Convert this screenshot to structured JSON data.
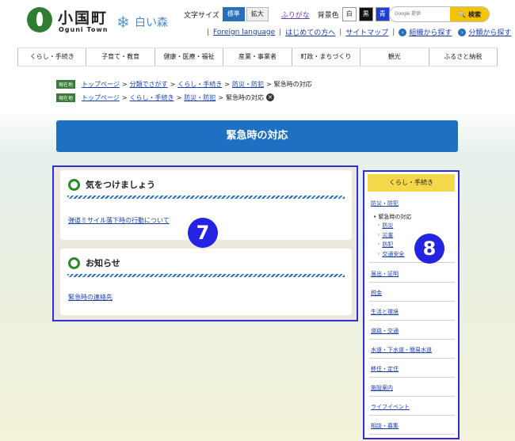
{
  "header": {
    "logo_text": "小国町",
    "logo_sub": "Oguni Town",
    "forest_text": "白い森",
    "font_size_label": "文字サイズ",
    "size_standard": "標準",
    "size_large": "拡大",
    "furigana": "ふりがな",
    "bg_label": "背景色",
    "bg_white": "白",
    "bg_black": "黒",
    "bg_blue": "青",
    "search_placeholder": "Google 提供",
    "search_button": "検索",
    "links": [
      "Foreign language",
      "はじめての方へ",
      "サイトマップ"
    ],
    "find_by_org": "組織から探す",
    "find_by_category": "分類から探す"
  },
  "nav": [
    "くらし・手続き",
    "子育て・教育",
    "健康・医療・福祉",
    "産業・事業者",
    "町政・まちづくり",
    "観光",
    "ふるさと納税"
  ],
  "breadcrumbs": {
    "row1_tag": "現在地",
    "row1": [
      "トップページ",
      "分類でさがす",
      "くらし・手続き",
      "防災・防犯"
    ],
    "row1_current": "緊急時の対応",
    "row2_tag": "現在地",
    "row2": [
      "トップページ",
      "くらし・手続き",
      "防災・防犯"
    ],
    "row2_current": "緊急時の対応"
  },
  "page_title": "緊急時の対応",
  "sections": [
    {
      "heading": "気をつけましょう",
      "link": "弾道ミサイル落下時の行動について"
    },
    {
      "heading": "お知らせ",
      "link": "緊急時の連絡先"
    }
  ],
  "badges": {
    "main": "7",
    "side": "8"
  },
  "sidebar": {
    "head": "くらし・手続き",
    "parent": "防災・防犯",
    "current": "緊急時の対応",
    "subs": [
      "防災",
      "災害",
      "防犯",
      "交通安全"
    ],
    "items": [
      "届出・証明",
      "税金",
      "生活と環境",
      "道路・交通",
      "水道・下水道・簡易水道",
      "移住・定住",
      "施設案内",
      "ライフイベント",
      "相談・募集"
    ]
  },
  "colors": {
    "accent_blue": "#1d70c2",
    "green": "#2a8a2a",
    "highlight_border": "#2f2fd8",
    "sidebar_head": "#f5d84a"
  }
}
